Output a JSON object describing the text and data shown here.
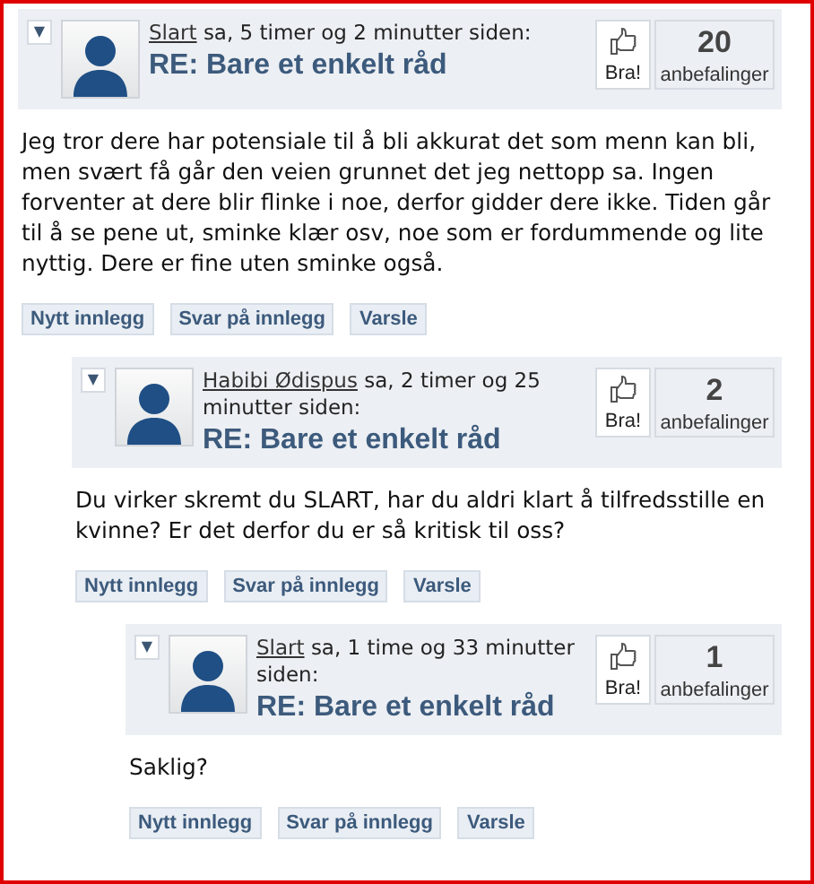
{
  "posts": [
    {
      "toggle": "▼",
      "author": "Slart",
      "said": "sa, 5 timer og 2 minutter siden:",
      "title": "RE: Bare et enkelt råd",
      "vote_label": "Bra!",
      "count": "20",
      "count_label": "anbefalinger",
      "body": "Jeg tror dere har potensiale til å bli akkurat det som menn kan bli, men svært få går den veien grunnet det jeg nettopp sa. Ingen forventer at dere blir flinke i noe, derfor gidder dere ikke. Tiden går til å se pene ut, sminke klær osv, noe som er fordummende og lite nyttig. Dere er fine uten sminke også.",
      "actions": [
        "Nytt innlegg",
        "Svar på innlegg",
        "Varsle"
      ],
      "children": [
        {
          "toggle": "▼",
          "author": "Habibi Ødispus",
          "said": "sa, 2 timer og 25 minutter siden:",
          "title": "RE: Bare et enkelt råd",
          "vote_label": "Bra!",
          "count": "2",
          "count_label": "anbefalinger",
          "body": "Du virker skremt du SLART, har du aldri klart å tilfredsstille en kvinne? Er det derfor du er så kritisk til oss?",
          "actions": [
            "Nytt innlegg",
            "Svar på innlegg",
            "Varsle"
          ],
          "children": [
            {
              "toggle": "▼",
              "author": "Slart",
              "said": "sa, 1 time og 33 minutter siden:",
              "title": "RE: Bare et enkelt råd",
              "vote_label": "Bra!",
              "count": "1",
              "count_label": "anbefalinger",
              "body": "Saklig?",
              "actions": [
                "Nytt innlegg",
                "Svar på innlegg",
                "Varsle"
              ]
            }
          ]
        }
      ]
    }
  ]
}
